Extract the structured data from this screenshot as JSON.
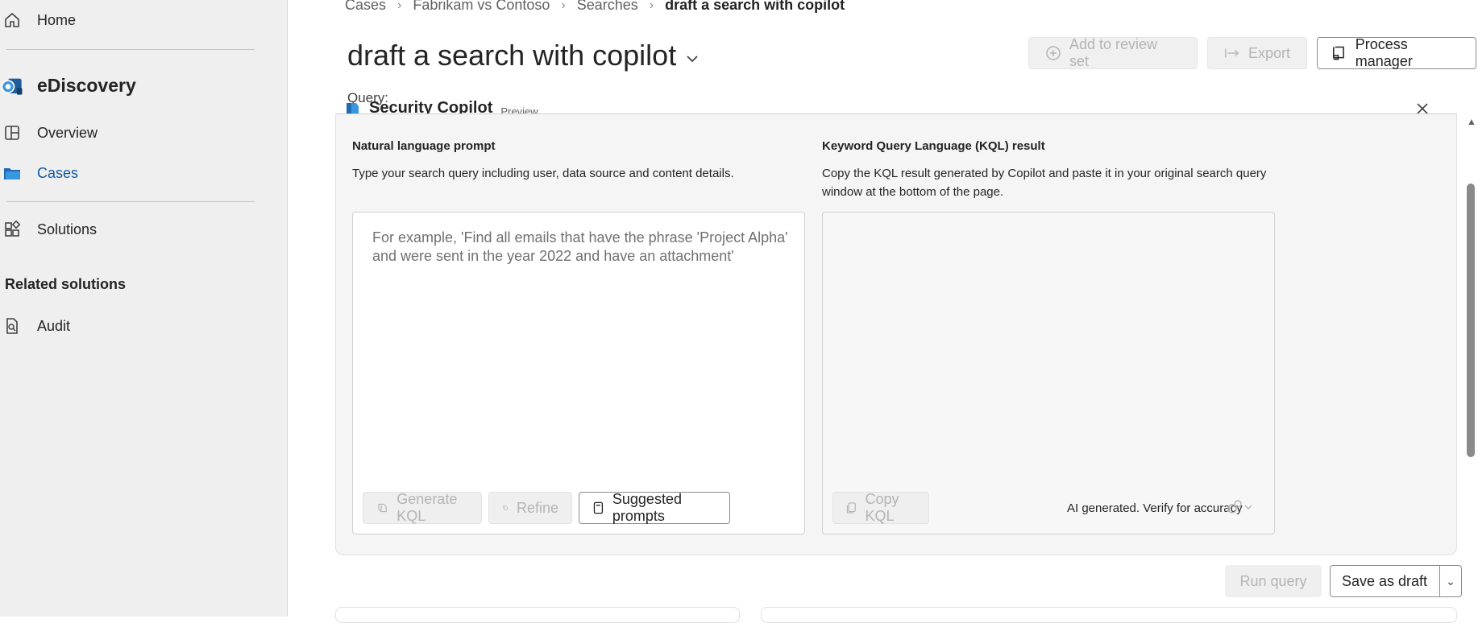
{
  "sidebar": {
    "home": "Home",
    "app_name": "eDiscovery",
    "overview": "Overview",
    "cases": "Cases",
    "solutions": "Solutions",
    "related_heading": "Related solutions",
    "audit": "Audit"
  },
  "breadcrumb": {
    "items": [
      "Cases",
      "Fabrikam vs Contoso",
      "Searches"
    ],
    "current": "draft a search with copilot"
  },
  "page": {
    "title": "draft a search with copilot",
    "query_label": "Query:"
  },
  "toolbar": {
    "add_to_review_set": "Add to review set",
    "export": "Export",
    "process_manager": "Process manager"
  },
  "copilot": {
    "title": "Security Copilot",
    "badge": "Preview",
    "nl_heading": "Natural language prompt",
    "nl_description": "Type your search query including user, data source and content details.",
    "nl_placeholder": "For example, 'Find all emails that have the phrase 'Project Alpha' and were sent in the year 2022 and have an attachment'",
    "kql_heading": "Keyword Query Language (KQL) result",
    "kql_description": "Copy the KQL result generated by Copilot and paste it in your original search query window at the bottom of the page.",
    "generate_kql": "Generate KQL",
    "refine": "Refine",
    "suggested_prompts": "Suggested prompts",
    "copy_kql": "Copy KQL",
    "ai_note": "AI generated. Verify for accuracy"
  },
  "footer": {
    "run_query": "Run query",
    "save_as_draft": "Save as draft"
  },
  "colors": {
    "accent": "#0f5aa0",
    "disabled_text": "#b4b4b4",
    "sidebar_bg": "#efefef"
  }
}
